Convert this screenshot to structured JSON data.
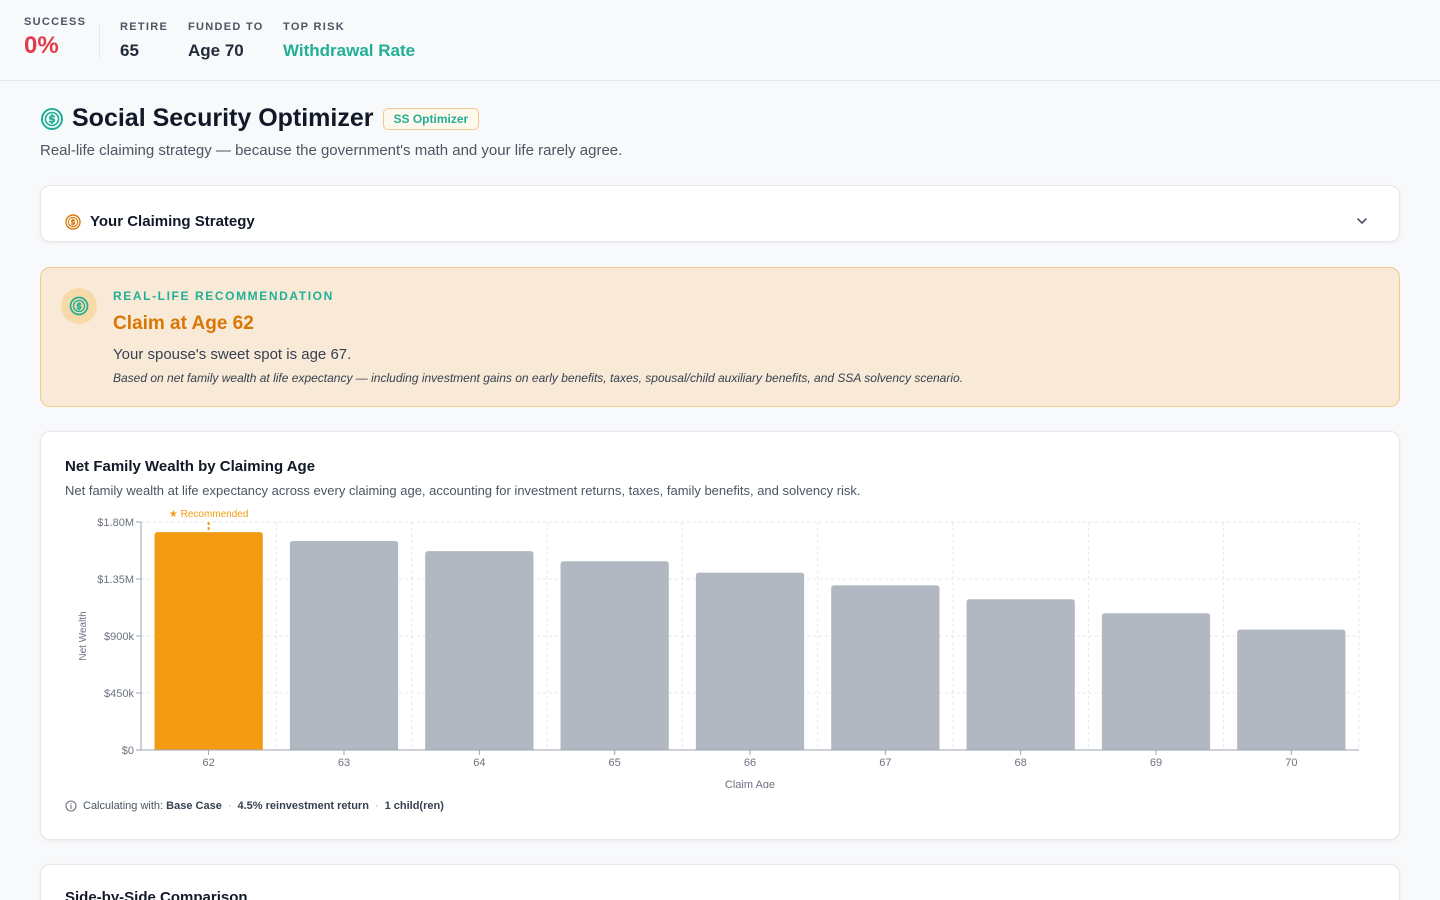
{
  "topbar": {
    "success": {
      "label": "SUCCESS",
      "value": "0%"
    },
    "retire": {
      "label": "RETIRE",
      "value": "65"
    },
    "funded": {
      "label": "FUNDED TO",
      "value": "Age 70"
    },
    "risk": {
      "label": "TOP RISK",
      "value": "Withdrawal Rate"
    }
  },
  "page": {
    "title": "Social Security Optimizer",
    "badge": "SS Optimizer",
    "subtitle": "Real-life claiming strategy — because the government's math and your life rarely agree."
  },
  "strategy": {
    "title": "Your Claiming Strategy",
    "icon": "dollar-circle-icon"
  },
  "recommendation": {
    "label": "REAL-LIFE RECOMMENDATION",
    "title": "Claim at Age 62",
    "sub": "Your spouse's sweet spot is age 67.",
    "note": "Based on net family wealth at life expectancy — including investment gains on early benefits, taxes, spousal/child auxiliary benefits, and SSA solvency scenario."
  },
  "chart_card": {
    "title": "Net Family Wealth by Claiming Age",
    "sub": "Net family wealth at life expectancy across every claiming age, accounting for investment returns, taxes, family benefits, and solvency risk.",
    "calc_prefix": "Calculating with:",
    "calc_scenario": "Base Case",
    "calc_return": "4.5% reinvestment return",
    "calc_children": "1 child(ren)"
  },
  "chart_data": {
    "type": "bar",
    "categories": [
      "62",
      "63",
      "64",
      "65",
      "66",
      "67",
      "68",
      "69",
      "70"
    ],
    "values": [
      1720000,
      1650000,
      1570000,
      1490000,
      1400000,
      1300000,
      1190000,
      1080000,
      950000
    ],
    "ylabel": "Net Wealth",
    "xlabel": "Claim Age",
    "ylim": [
      0,
      1800000
    ],
    "yticks": [
      0,
      450000,
      900000,
      1350000,
      1800000
    ],
    "ytick_labels": [
      "$0",
      "$450k",
      "$900k",
      "$1.35M",
      "$1.80M"
    ],
    "highlight_index": 0,
    "highlight_label": "★ Recommended",
    "colors": {
      "highlight": "#f39c12",
      "bar": "#b1b8c1",
      "grid": "#e5e7eb",
      "axis": "#9ca3af"
    }
  },
  "compare": {
    "title": "Side-by-Side Comparison"
  }
}
